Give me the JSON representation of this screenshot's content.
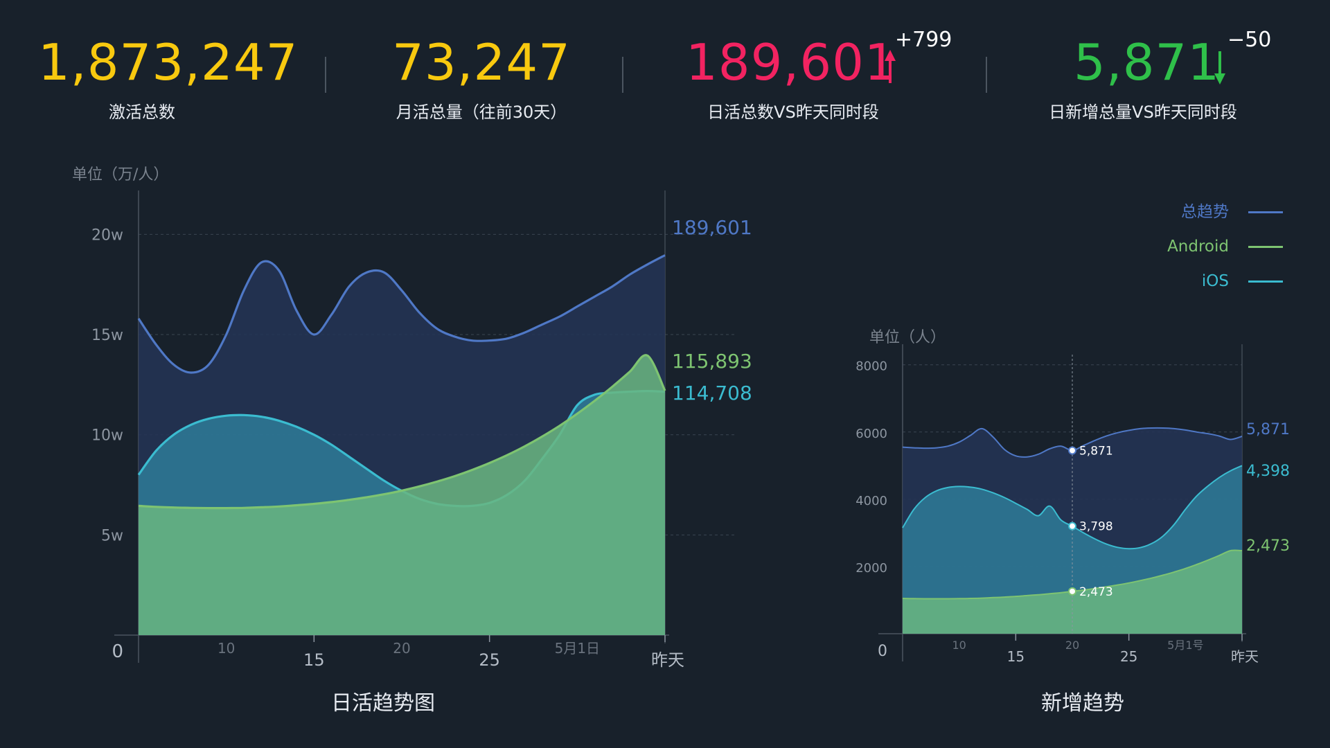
{
  "kpis": {
    "activations": {
      "value": "1,873,247",
      "label": "激活总数",
      "color": "#f8c90f"
    },
    "mau": {
      "value": "73,247",
      "label": "月活总量（往前30天）",
      "color": "#f8c90f"
    },
    "dau": {
      "value": "189,601",
      "label": "日活总数VS昨天同时段",
      "color": "#f22361",
      "delta": "+799",
      "direction": "up"
    },
    "new_users": {
      "value": "5,871",
      "label": "日新增总量VS昨天同时段",
      "color": "#2fc04a",
      "delta": "−50",
      "direction": "down"
    }
  },
  "legend": [
    {
      "name": "总趋势",
      "color": "#4f78c6"
    },
    {
      "name": "Android",
      "color": "#7ec471"
    },
    {
      "name": "iOS",
      "color": "#3bbcd0"
    }
  ],
  "chart_data": [
    {
      "type": "area",
      "title": "日活趋势图",
      "unit_label": "单位（万/人）",
      "ylim": [
        0,
        215000
      ],
      "y_ticks": [
        {
          "value": 0,
          "label": "0"
        },
        {
          "value": 50000,
          "label": "5w"
        },
        {
          "value": 100000,
          "label": "10w"
        },
        {
          "value": 150000,
          "label": "15w"
        },
        {
          "value": 200000,
          "label": "20w"
        }
      ],
      "x_ticks_minor": [
        {
          "i": 5,
          "label": "10"
        },
        {
          "i": 15,
          "label": "20"
        },
        {
          "i": 25,
          "label": "5月1日"
        }
      ],
      "x_ticks_major": [
        {
          "i": 10,
          "label": "15"
        },
        {
          "i": 20,
          "label": "25"
        },
        {
          "i": 30,
          "label": "昨天"
        }
      ],
      "grid": true,
      "x_count": 31,
      "series": [
        {
          "name": "总趋势",
          "color": "#4f78c6",
          "end_label": "189,601",
          "values": [
            158000,
            145000,
            135000,
            131000,
            135000,
            150000,
            172000,
            186000,
            182000,
            162000,
            150000,
            160000,
            174000,
            181000,
            181000,
            172000,
            161000,
            153000,
            149000,
            147000,
            147000,
            148000,
            151000,
            155000,
            159000,
            164000,
            169000,
            174000,
            180000,
            185000,
            189601
          ]
        },
        {
          "name": "Android",
          "color": "#7ec471",
          "end_label": "115,893",
          "values": [
            64500,
            64000,
            63700,
            63500,
            63400,
            63400,
            63500,
            63800,
            64200,
            64800,
            65500,
            66400,
            67500,
            68800,
            70300,
            72100,
            74200,
            76600,
            79300,
            82400,
            85900,
            89800,
            94200,
            99100,
            104500,
            110500,
            117000,
            124000,
            131500,
            139500,
            122000
          ]
        },
        {
          "name": "iOS",
          "color": "#3bbcd0",
          "end_label": "114,708",
          "values": [
            80000,
            92000,
            100000,
            105000,
            108000,
            109500,
            109800,
            109000,
            107000,
            104000,
            100000,
            95000,
            89000,
            83000,
            77000,
            72000,
            68000,
            65500,
            64500,
            64500,
            66000,
            70000,
            77000,
            88000,
            100000,
            114708,
            120000,
            121000,
            121500,
            121800,
            121500
          ]
        }
      ]
    },
    {
      "type": "area",
      "title": "新增趋势",
      "unit_label": "单位（人）",
      "ylim": [
        0,
        8200
      ],
      "y_ticks": [
        {
          "value": 0,
          "label": "0"
        },
        {
          "value": 2000,
          "label": "2000"
        },
        {
          "value": 4000,
          "label": "4000"
        },
        {
          "value": 6000,
          "label": "6000"
        },
        {
          "value": 8000,
          "label": "8000"
        }
      ],
      "x_ticks_minor": [
        {
          "i": 5,
          "label": "10"
        },
        {
          "i": 15,
          "label": "20"
        },
        {
          "i": 25,
          "label": "5月1号"
        }
      ],
      "x_ticks_major": [
        {
          "i": 10,
          "label": "15"
        },
        {
          "i": 20,
          "label": "25"
        },
        {
          "i": 30,
          "label": "昨天"
        }
      ],
      "grid": true,
      "x_count": 31,
      "cursor_index": 15,
      "series": [
        {
          "name": "总趋势",
          "color": "#4f78c6",
          "end_label": "5,871",
          "cursor_label": "5,871",
          "values": [
            5550,
            5530,
            5520,
            5530,
            5580,
            5700,
            5900,
            6100,
            5850,
            5480,
            5290,
            5260,
            5340,
            5500,
            5580,
            5450,
            5600,
            5750,
            5880,
            5980,
            6050,
            6100,
            6120,
            6120,
            6100,
            6060,
            6000,
            5950,
            5880,
            5780,
            5871
          ]
        },
        {
          "name": "iOS",
          "color": "#3bbcd0",
          "end_label": "4,398",
          "cursor_label": "3,798",
          "values": [
            3150,
            3700,
            4050,
            4250,
            4350,
            4380,
            4360,
            4300,
            4190,
            4050,
            3880,
            3700,
            3510,
            3798,
            3380,
            3200,
            3000,
            2820,
            2670,
            2570,
            2530,
            2560,
            2680,
            2900,
            3250,
            3700,
            4100,
            4398,
            4650,
            4850,
            5000
          ]
        },
        {
          "name": "Android",
          "color": "#7ec471",
          "end_label": "2,473",
          "cursor_label": "2,473",
          "values": [
            1050,
            1045,
            1040,
            1040,
            1040,
            1045,
            1050,
            1060,
            1075,
            1090,
            1110,
            1135,
            1160,
            1190,
            1220,
            1260,
            1300,
            1345,
            1395,
            1450,
            1510,
            1580,
            1655,
            1740,
            1835,
            1940,
            2060,
            2190,
            2330,
            2473,
            2473
          ]
        }
      ]
    }
  ]
}
